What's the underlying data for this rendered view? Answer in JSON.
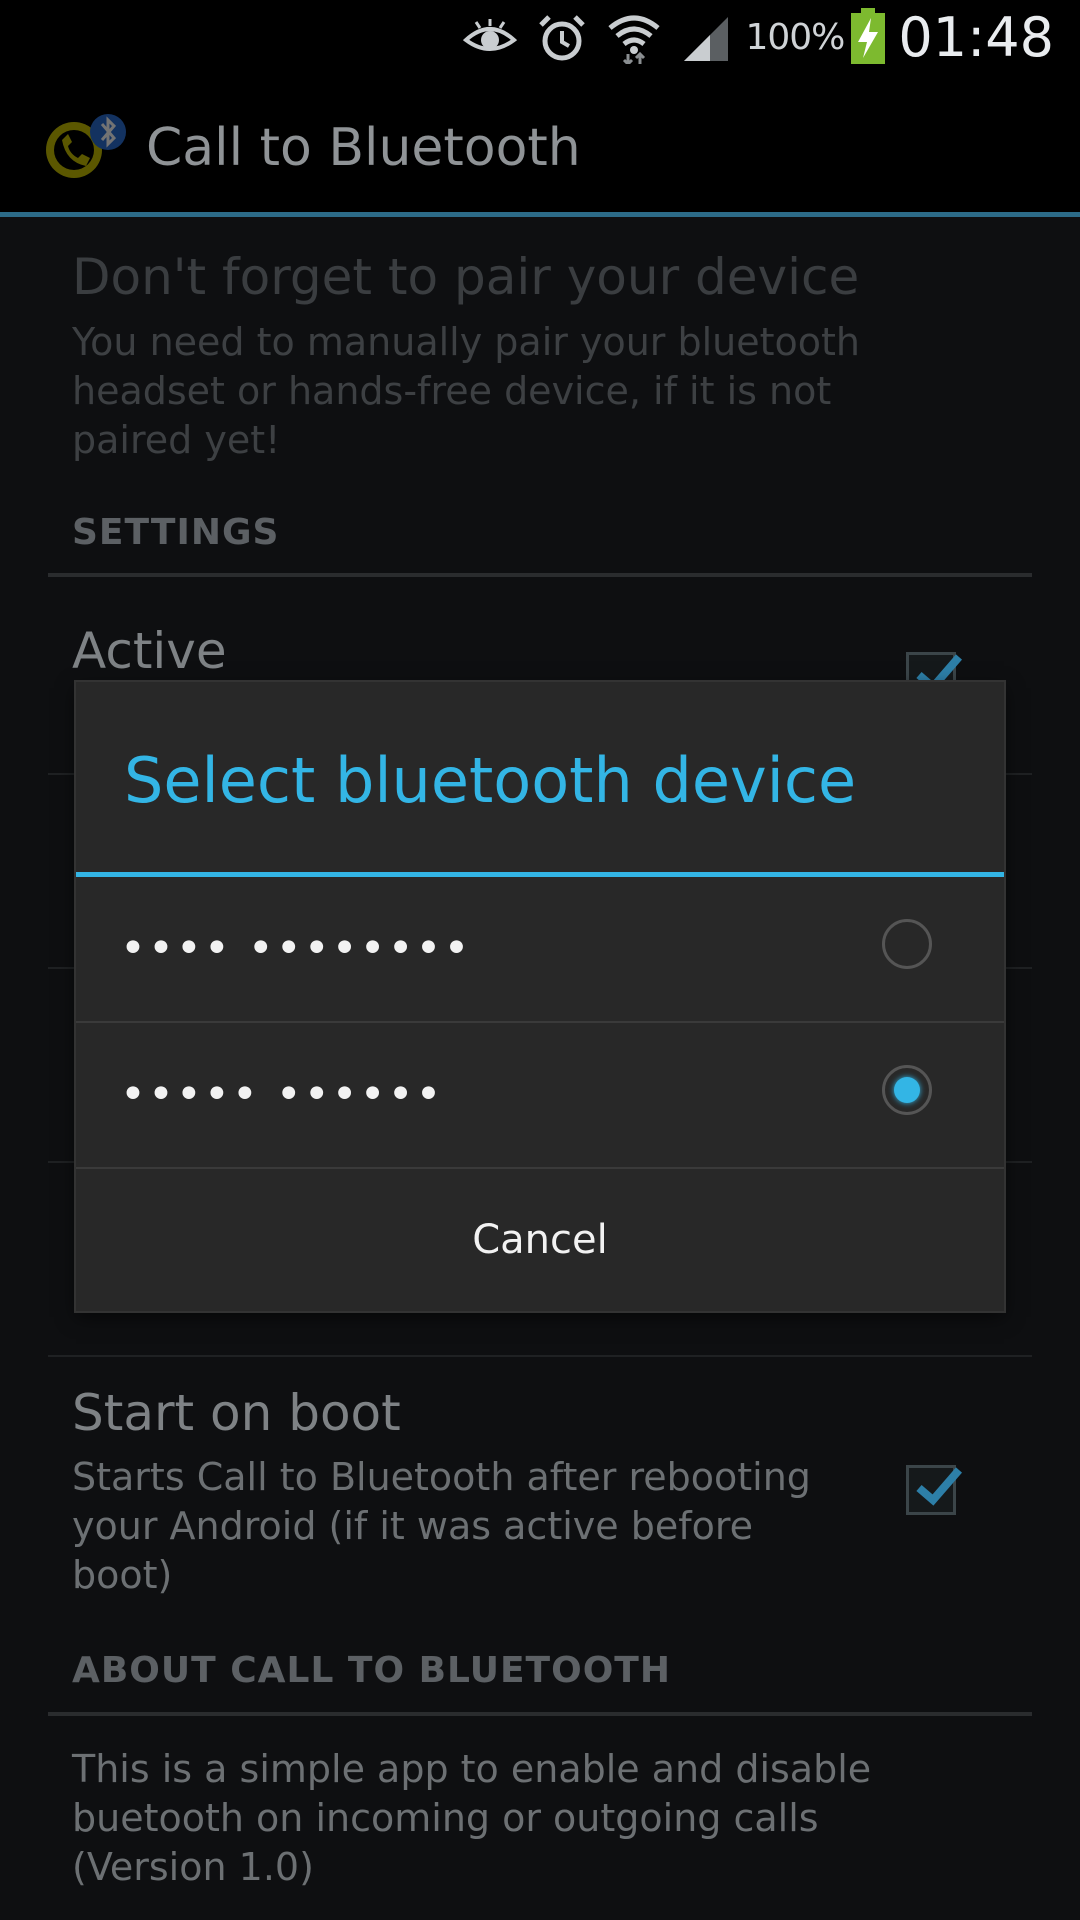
{
  "status_bar": {
    "battery_percent": "100%",
    "time": "01:48",
    "icons": [
      "eye-icon",
      "alarm-icon",
      "wifi-icon",
      "signal-icon",
      "battery-charging-icon"
    ]
  },
  "action_bar": {
    "title": "Call to Bluetooth",
    "app_icon": "call-to-bluetooth-app-icon"
  },
  "hint": {
    "title": "Don't forget to pair your device",
    "body": "You need to manually pair your bluetooth headset or hands-free device, if it is not paired yet!"
  },
  "settings": {
    "header": "SETTINGS",
    "active_title": "Active",
    "start_on_boot_title": "Start on boot",
    "start_on_boot_summary": "Starts Call to Bluetooth after rebooting your Android (if it was active before boot)"
  },
  "about": {
    "header": "ABOUT CALL TO BLUETOOTH",
    "body": "This is a simple app to enable and disable buetooth on incoming or outgoing calls (Version 1.0)"
  },
  "dialog": {
    "title": "Select bluetooth device",
    "items": [
      {
        "label": "•••• ••••••••",
        "selected": false
      },
      {
        "label": "••••• ••••••",
        "selected": true
      }
    ],
    "cancel_label": "Cancel"
  },
  "colors": {
    "accent": "#33b5e5",
    "dialog_bg": "#282828",
    "background": "#0e0f11"
  }
}
